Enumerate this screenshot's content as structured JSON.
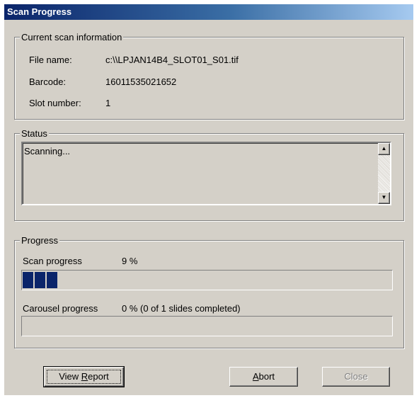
{
  "window": {
    "title": "Scan Progress"
  },
  "scan_info": {
    "legend": "Current scan information",
    "file_name_label": "File name:",
    "file_name_value": "c:\\\\LPJAN14B4_SLOT01_S01.tif",
    "barcode_label": "Barcode:",
    "barcode_value": "16011535021652",
    "slot_label": "Slot number:",
    "slot_value": "1"
  },
  "status": {
    "legend": "Status",
    "text": "Scanning...",
    "scroll_up_icon": "scroll-up-arrow",
    "scroll_down_icon": "scroll-down-arrow"
  },
  "progress": {
    "legend": "Progress",
    "scan_label": "Scan progress",
    "scan_value": "9 %",
    "scan_percent": 9,
    "carousel_label": "Carousel progress",
    "carousel_value": "0 % (0 of 1 slides completed)",
    "carousel_percent": 0,
    "bar_color": "#0a246a"
  },
  "buttons": {
    "view_report": {
      "before": "View ",
      "accel": "R",
      "after": "eport"
    },
    "abort": {
      "before": "",
      "accel": "A",
      "after": "bort"
    },
    "close": {
      "label": "Close",
      "enabled": false
    }
  }
}
